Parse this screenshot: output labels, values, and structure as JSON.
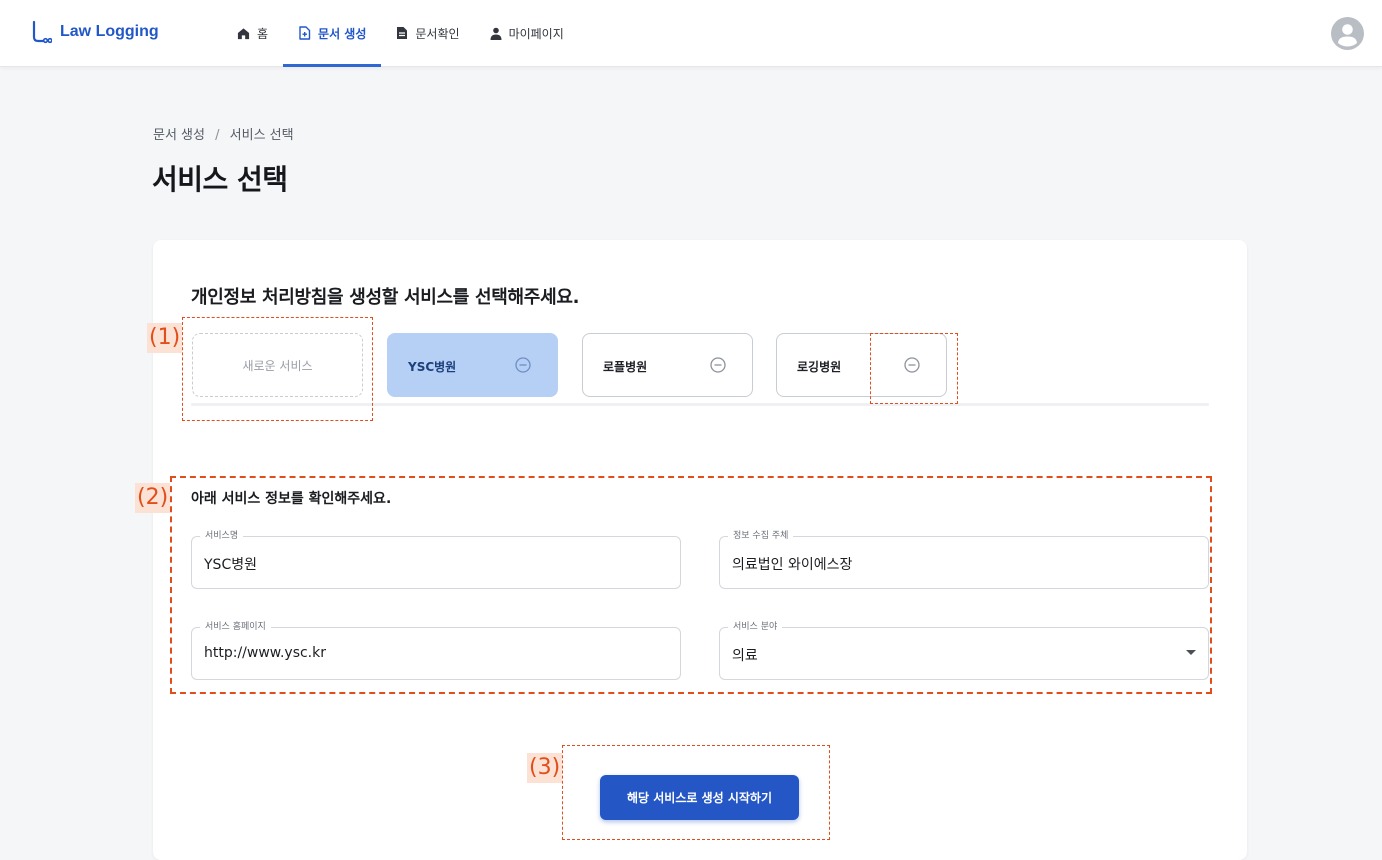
{
  "brand": {
    "name": "Law Logging",
    "color": "#2257c8"
  },
  "nav": {
    "items": [
      {
        "label": "홈",
        "icon": "home-icon"
      },
      {
        "label": "문서 생성",
        "icon": "document-add-icon",
        "active": true
      },
      {
        "label": "문서확인",
        "icon": "document-icon"
      },
      {
        "label": "마이페이지",
        "icon": "person-icon"
      }
    ]
  },
  "user": {
    "avatar_icon": "user-avatar-icon"
  },
  "breadcrumb": {
    "parent": "문서 생성",
    "separator": "/",
    "current": "서비스 선택"
  },
  "page": {
    "title": "서비스 선택"
  },
  "selection": {
    "heading": "개인정보 처리방침을 생성할 서비스를 선택해주세요.",
    "new_label": "새로운 서비스",
    "services": [
      {
        "name": "YSC병원",
        "selected": true
      },
      {
        "name": "로플병원",
        "selected": false
      },
      {
        "name": "로깅병원",
        "selected": false
      }
    ]
  },
  "info": {
    "heading": "아래 서비스 정보를 확인해주세요.",
    "fields": {
      "service_name": {
        "label": "서비스명",
        "value": "YSC병원"
      },
      "collector": {
        "label": "정보 수집 주체",
        "value": "의료법인 와이에스장"
      },
      "homepage": {
        "label": "서비스 홈페이지",
        "value": "http://www.ysc.kr"
      },
      "category": {
        "label": "서비스 분야",
        "value": "의료"
      }
    }
  },
  "action": {
    "start_label": "해당 서비스로 생성 시작하기",
    "color": "#2457c5"
  },
  "annotations": {
    "one": "(1)",
    "two": "(2)",
    "three": "(3)",
    "color": "#e24e1b"
  }
}
